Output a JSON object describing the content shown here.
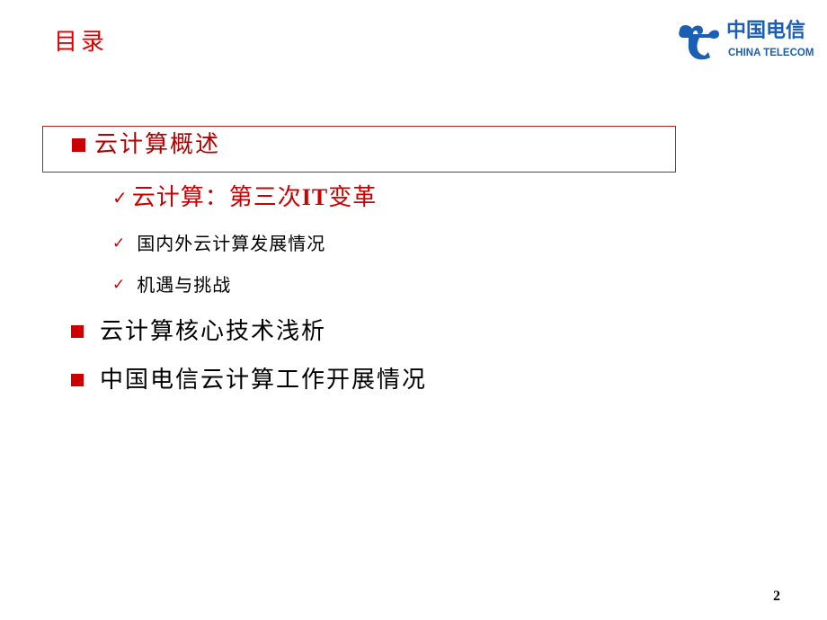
{
  "slide": {
    "title": "目录",
    "page_number": "2"
  },
  "logo": {
    "icon": "china-telecom-logo-icon",
    "name_cn": "中国电信",
    "name_en": "CHINA TELECOM",
    "color": "#1a5fb4"
  },
  "outline": {
    "sections": [
      {
        "label": "云计算概述",
        "active": true,
        "subitems": [
          {
            "label_prefix": "云计算：第三次",
            "label_it": "IT",
            "label_suffix": "变革",
            "active": true
          },
          {
            "label": "国内外云计算发展情况",
            "active": false
          },
          {
            "label": "机遇与挑战",
            "active": false
          }
        ]
      },
      {
        "label": "云计算核心技术浅析",
        "active": false
      },
      {
        "label": "中国电信云计算工作开展情况",
        "active": false
      }
    ]
  },
  "colors": {
    "title": "#e00000",
    "bullet": "#cc0000",
    "active_text": "#b30000",
    "box_border": "#b22222"
  },
  "icons": {
    "section_bullet": "square-bullet-icon",
    "sub_bullet": "checkmark-icon",
    "check_glyph": "✓"
  }
}
